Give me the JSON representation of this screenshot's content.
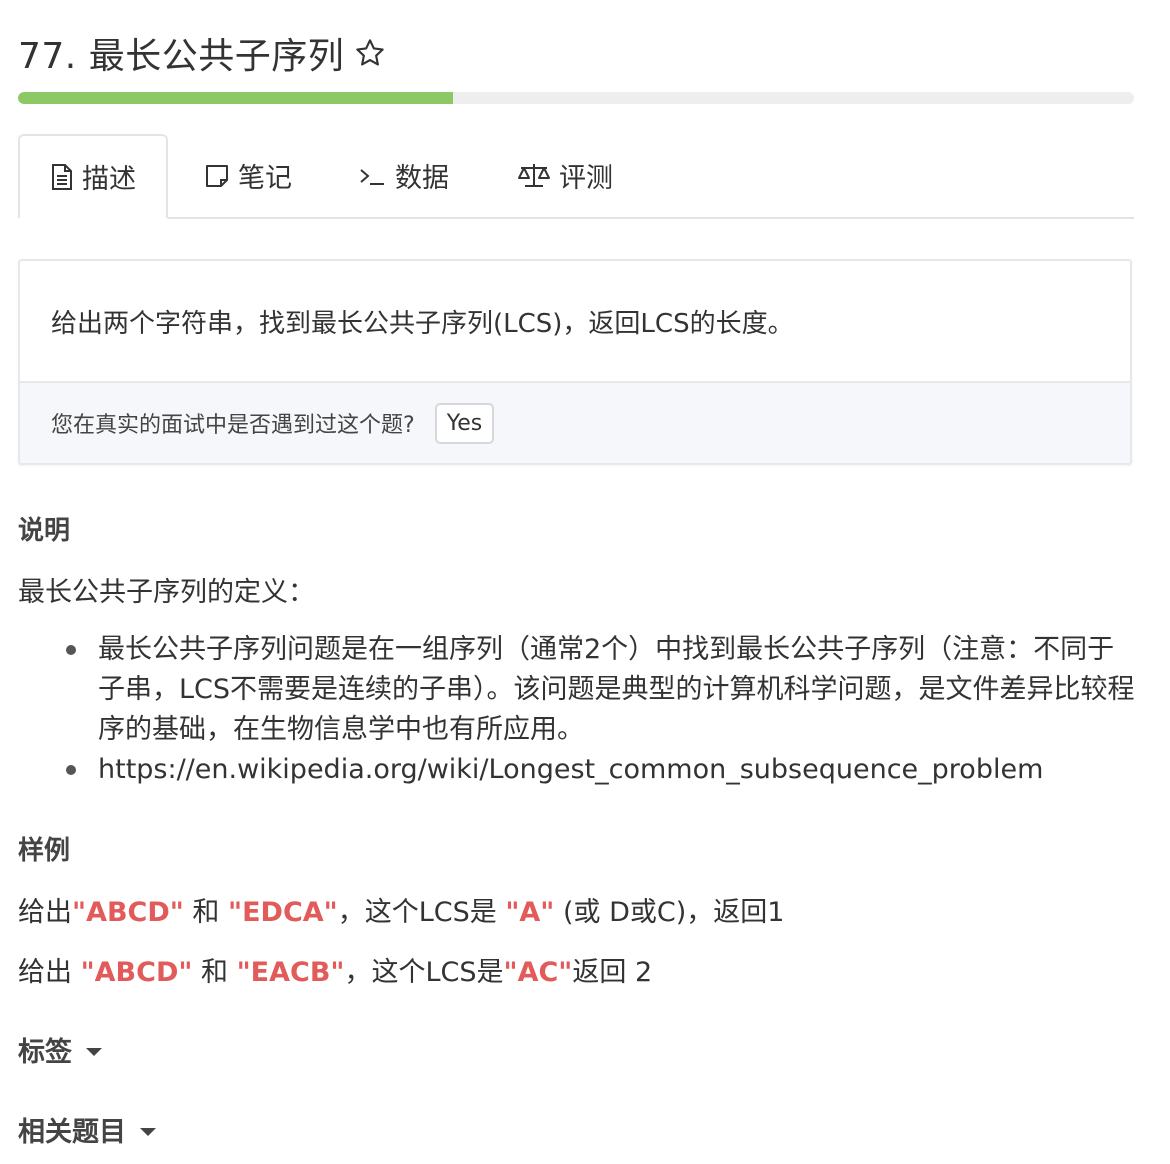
{
  "problem": {
    "title": "77. 最长公共子序列",
    "progress_percent": 39
  },
  "tabs": [
    {
      "label": "描述",
      "icon": "document-icon",
      "active": true
    },
    {
      "label": "笔记",
      "icon": "note-icon",
      "active": false
    },
    {
      "label": "数据",
      "icon": "terminal-icon",
      "active": false
    },
    {
      "label": "评测",
      "icon": "scale-icon",
      "active": false
    }
  ],
  "card": {
    "description": "给出两个字符串，找到最长公共子序列(LCS)，返回LCS的长度。",
    "question": "您在真实的面试中是否遇到过这个题?",
    "yes_label": "Yes"
  },
  "explanation": {
    "heading": "说明",
    "intro": "最长公共子序列的定义：",
    "items": [
      "最长公共子序列问题是在一组序列（通常2个）中找到最长公共子序列（注意：不同于子串，LCS不需要是连续的子串）。该问题是典型的计算机科学问题，是文件差异比较程序的基础，在生物信息学中也有所应用。",
      "https://en.wikipedia.org/wiki/Longest_common_subsequence_problem"
    ]
  },
  "examples": {
    "heading": "样例",
    "ex1": {
      "t1": "给出",
      "s1": "\"ABCD\"",
      "t2": " 和 ",
      "s2": "\"EDCA\"",
      "t3": "，这个LCS是 ",
      "s3": "\"A\"",
      "t4": " (或 D或C)，返回1"
    },
    "ex2": {
      "t1": "给出 ",
      "s1": "\"ABCD\"",
      "t2": " 和 ",
      "s2": "\"EACB\"",
      "t3": "，这个LCS是",
      "s3": "\"AC\"",
      "t4": "返回 2"
    }
  },
  "tags_label": "标签",
  "related_label": "相关题目",
  "colors": {
    "progress": "#8cc964",
    "highlight": "#e25a5a"
  }
}
